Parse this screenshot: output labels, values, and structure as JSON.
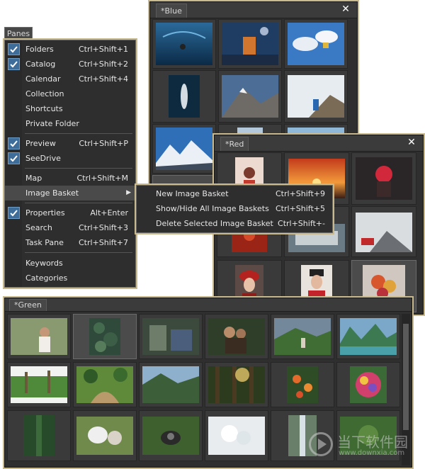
{
  "panes_tab": "Panes",
  "blue_pane": {
    "title": "*Blue",
    "close": "✕"
  },
  "red_pane": {
    "title": "*Red",
    "close": "✕"
  },
  "green_pane": {
    "title": "*Green"
  },
  "menu": {
    "items": [
      {
        "label": "Folders",
        "shortcut": "Ctrl+Shift+1",
        "checked": true
      },
      {
        "label": "Catalog",
        "shortcut": "Ctrl+Shift+2",
        "checked": true
      },
      {
        "label": "Calendar",
        "shortcut": "Ctrl+Shift+4",
        "checked": false
      },
      {
        "label": "Collection",
        "shortcut": "",
        "checked": false
      },
      {
        "label": "Shortcuts",
        "shortcut": "",
        "checked": false
      },
      {
        "label": "Private Folder",
        "shortcut": "",
        "checked": false
      },
      {
        "label": "Preview",
        "shortcut": "Ctrl+Shift+P",
        "checked": true
      },
      {
        "label": "SeeDrive",
        "shortcut": "",
        "checked": true
      },
      {
        "label": "Map",
        "shortcut": "Ctrl+Shift+M",
        "checked": false
      },
      {
        "label": "Image Basket",
        "shortcut": "",
        "checked": false
      },
      {
        "label": "Properties",
        "shortcut": "Alt+Enter",
        "checked": true
      },
      {
        "label": "Search",
        "shortcut": "Ctrl+Shift+3",
        "checked": false
      },
      {
        "label": "Task Pane",
        "shortcut": "Ctrl+Shift+7",
        "checked": false
      },
      {
        "label": "Keywords",
        "shortcut": "",
        "checked": false
      },
      {
        "label": "Categories",
        "shortcut": "",
        "checked": false
      }
    ]
  },
  "submenu": {
    "items": [
      {
        "label": "New Image Basket",
        "shortcut": "Ctrl+Shift+9"
      },
      {
        "label": "Show/Hide All Image Baskets",
        "shortcut": "Ctrl+Shift+5"
      },
      {
        "label": "Delete Selected Image Basket",
        "shortcut": "Ctrl+Shift+-"
      }
    ]
  },
  "watermark": {
    "text": "当下软件园",
    "sub": "www.downxia.com"
  },
  "colors": {
    "accent_check": "#3f6d9a",
    "pane_bg": "#2f2f2f",
    "menu_bg": "#2e2e2e",
    "highlight": "#4a4a4a"
  }
}
